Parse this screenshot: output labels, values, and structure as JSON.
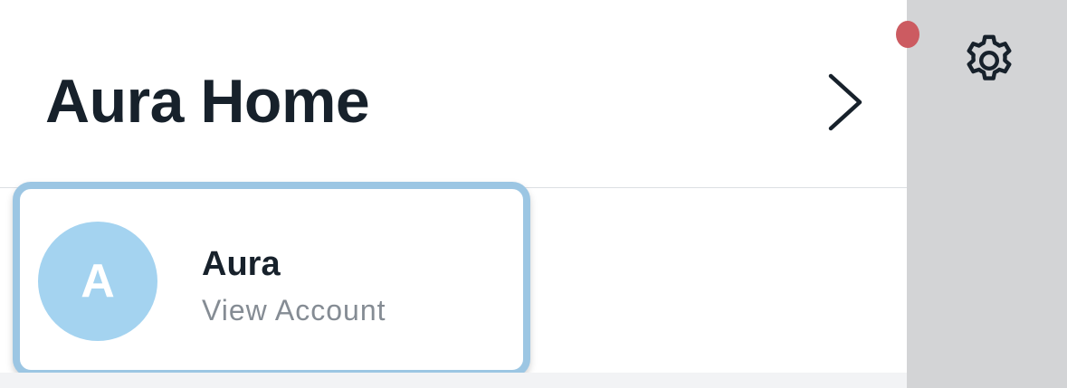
{
  "header": {
    "title": "Aura Home"
  },
  "account": {
    "avatar_initial": "A",
    "name": "Aura",
    "subtitle": "View Account"
  },
  "icons": {
    "chevron": "chevron-right-icon",
    "settings": "gear-icon",
    "notification": "notification-dot"
  },
  "colors": {
    "title_text": "#17212b",
    "avatar_bg": "#a4d3f0",
    "card_highlight": "#9cc6e3",
    "notification_dot": "#cc5b61",
    "side_panel_bg": "#d3d4d6"
  }
}
